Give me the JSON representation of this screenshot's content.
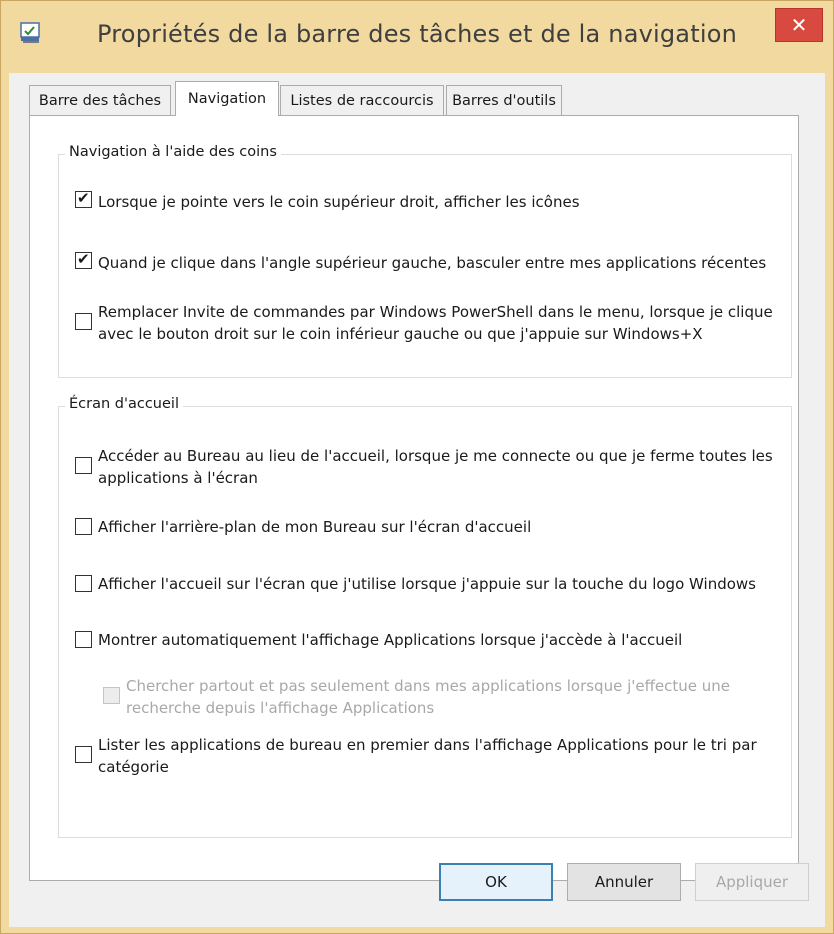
{
  "window": {
    "title": "Propriétés de la barre des tâches et de la navigation",
    "close_label": "✕"
  },
  "tabs": [
    {
      "label": "Barre des tâches",
      "active": false
    },
    {
      "label": "Navigation",
      "active": true
    },
    {
      "label": "Listes de raccourcis",
      "active": false
    },
    {
      "label": "Barres d'outils",
      "active": false
    }
  ],
  "groups": {
    "corners": {
      "label": "Navigation à l'aide des coins",
      "options": [
        {
          "label": "Lorsque je pointe vers le coin supérieur droit, afficher les icônes",
          "checked": true,
          "enabled": true
        },
        {
          "label": "Quand je clique dans l'angle supérieur gauche, basculer entre mes applications récentes",
          "checked": true,
          "enabled": true
        },
        {
          "label": "Remplacer Invite de commandes par Windows PowerShell dans le menu, lorsque je clique avec le bouton droit sur le coin inférieur gauche ou que j'appuie sur Windows+X",
          "checked": false,
          "enabled": true
        }
      ]
    },
    "start": {
      "label": "Écran d'accueil",
      "options": [
        {
          "label": "Accéder au Bureau au lieu de l'accueil, lorsque je me connecte ou que je ferme toutes les applications à l'écran",
          "checked": false,
          "enabled": true
        },
        {
          "label": "Afficher l'arrière-plan de mon Bureau sur l'écran d'accueil",
          "checked": false,
          "enabled": true
        },
        {
          "label": "Afficher l'accueil sur l'écran que j'utilise lorsque j'appuie sur la touche du logo Windows",
          "checked": false,
          "enabled": true
        },
        {
          "label": "Montrer automatiquement l'affichage Applications lorsque j'accède à l'accueil",
          "checked": false,
          "enabled": true
        },
        {
          "label": "Chercher partout et pas seulement dans mes applications lorsque j'effectue une recherche depuis l'affichage Applications",
          "checked": false,
          "enabled": false
        },
        {
          "label": "Lister les applications de bureau en premier dans l'affichage Applications pour le tri par catégorie",
          "checked": false,
          "enabled": true
        }
      ]
    }
  },
  "buttons": {
    "ok": "OK",
    "cancel": "Annuler",
    "apply": "Appliquer"
  },
  "colors": {
    "frame": "#f1d9a0",
    "close": "#d84a3f",
    "default_button_border": "#3c7fb1"
  }
}
